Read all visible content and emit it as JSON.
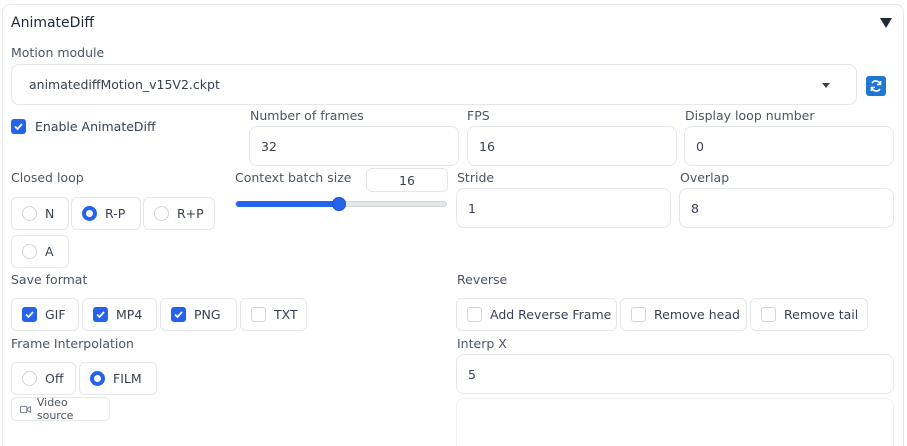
{
  "panel": {
    "title": "AnimateDiff"
  },
  "motion_module": {
    "label": "Motion module",
    "value": "animatediffMotion_v15V2.ckpt"
  },
  "enable": {
    "label": "Enable AnimateDiff",
    "checked": true
  },
  "number_of_frames": {
    "label": "Number of frames",
    "value": "32"
  },
  "fps": {
    "label": "FPS",
    "value": "16"
  },
  "display_loop": {
    "label": "Display loop number",
    "value": "0"
  },
  "closed_loop": {
    "label": "Closed loop",
    "options": [
      {
        "label": "N",
        "selected": false
      },
      {
        "label": "R-P",
        "selected": true
      },
      {
        "label": "R+P",
        "selected": false
      },
      {
        "label": "A",
        "selected": false
      }
    ]
  },
  "context_batch": {
    "label": "Context batch size",
    "value": "16",
    "min": 1,
    "max": 32,
    "level": 16
  },
  "stride": {
    "label": "Stride",
    "value": "1"
  },
  "overlap": {
    "label": "Overlap",
    "value": "8"
  },
  "save_format": {
    "label": "Save format",
    "options": [
      {
        "label": "GIF",
        "checked": true
      },
      {
        "label": "MP4",
        "checked": true
      },
      {
        "label": "PNG",
        "checked": true
      },
      {
        "label": "TXT",
        "checked": false
      }
    ]
  },
  "reverse": {
    "label": "Reverse",
    "options": [
      {
        "label": "Add Reverse Frame",
        "checked": false
      },
      {
        "label": "Remove head",
        "checked": false
      },
      {
        "label": "Remove tail",
        "checked": false
      }
    ]
  },
  "frame_interpolation": {
    "label": "Frame Interpolation",
    "options": [
      {
        "label": "Off",
        "selected": false
      },
      {
        "label": "FILM",
        "selected": true
      }
    ]
  },
  "interp_x": {
    "label": "Interp X",
    "value": "5"
  },
  "video_source": {
    "label": "Video source",
    "icon": "video-camera-icon"
  },
  "colors": {
    "accent": "#2563eb",
    "border": "#e5e7eb",
    "refresh": "#1f77d0"
  }
}
